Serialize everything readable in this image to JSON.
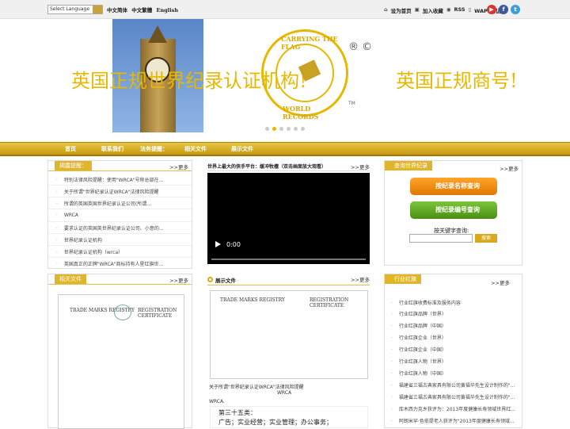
{
  "topbar": {
    "lang_select": "Select Language",
    "lang_links": [
      "中文简体",
      "中文繁體",
      "English"
    ],
    "links": [
      "设为首页",
      "加入收藏",
      "RSS",
      "WAP手机版"
    ]
  },
  "banner": {
    "slogan_left": "英国正规世界纪录认证机构!",
    "slogan_right": "英国正规商号!",
    "logo_top": "CARRYING THE FLAG",
    "logo_bottom": "WORLD RECORDS",
    "reg_marks": "® ©",
    "tm": "TM"
  },
  "nav": [
    "首页",
    "联系我们",
    "法务提醒：",
    "相关文件",
    "展示文件"
  ],
  "legal_panel": {
    "title": "揭露提醒：",
    "more": ">>更多",
    "items": [
      "特别法律风险提醒：使用\"WRCA\"号称总部在...",
      "关于所谓\"世界纪录认证WRCA\"法律风险提醒",
      "所谓的英国英国世界纪录认证公司(所谓...",
      "WRCA",
      "要求认证的英国英世界纪录认证公司、小意的...",
      "世界纪录认证机构",
      "世界纪录认证机构（wrca）",
      "英国真正的正牌\"WRCA\"商标持有人星红旗世..."
    ]
  },
  "video_panel": {
    "title": "世界上最大的侠手平台：缓冲牧檀（双击画面放大观看）",
    "more": ">>更多",
    "time": "0:00"
  },
  "query_panel": {
    "title": "查询世界纪录",
    "more": ">>更多",
    "btn_name": "按纪录名称查询",
    "btn_number": "按纪录编号查询",
    "keyword_label": "按关键字查询:",
    "search_btn": "搜索",
    "colors": {
      "orange": "#f08a00",
      "green": "#5aa01e"
    }
  },
  "files_panel": {
    "title": "相关文件",
    "more": ">>更多",
    "doc_left": "TRADE MARKS REGISTRY",
    "doc_right": "REGISTRATION CERTIFICATE"
  },
  "show_panel": {
    "title": "展示文件",
    "more": ">>更多",
    "doc_left": "TRADE MARKS REGISTRY",
    "doc_right": "REGISTRATION CERTIFICATE",
    "caption": "关于所谓\"世界纪录认证WRCA\"法律风险提醒",
    "img_alt": "WRCA",
    "text": "WRCA.",
    "doc2_line1": "第三十五类：",
    "doc2_line2": "广告；实业经营；实业管理；办公事务；"
  },
  "industry_panel": {
    "title": "行业红旗",
    "more": ">>更多",
    "items": [
      "行业红旗收费标准及服务内容",
      "行业红旗品牌（世界）",
      "行业红旗品牌（中国）",
      "行业红旗企业（世界）",
      "行业红旗企业（中国）",
      "行业红旗人物（世界）",
      "行业红旗人物（中国）",
      "福建省三福古典家具有限公司黄福华先生设计制作的\"...",
      "福建省三福古典家具有限公司黄福华先生设计制作的\"...",
      "库木西力克乡获评为：2013年度健康长寿领域世界红...",
      "阿朗米罕·色依提老人获评为\"2013年度健康长寿领域..."
    ]
  }
}
